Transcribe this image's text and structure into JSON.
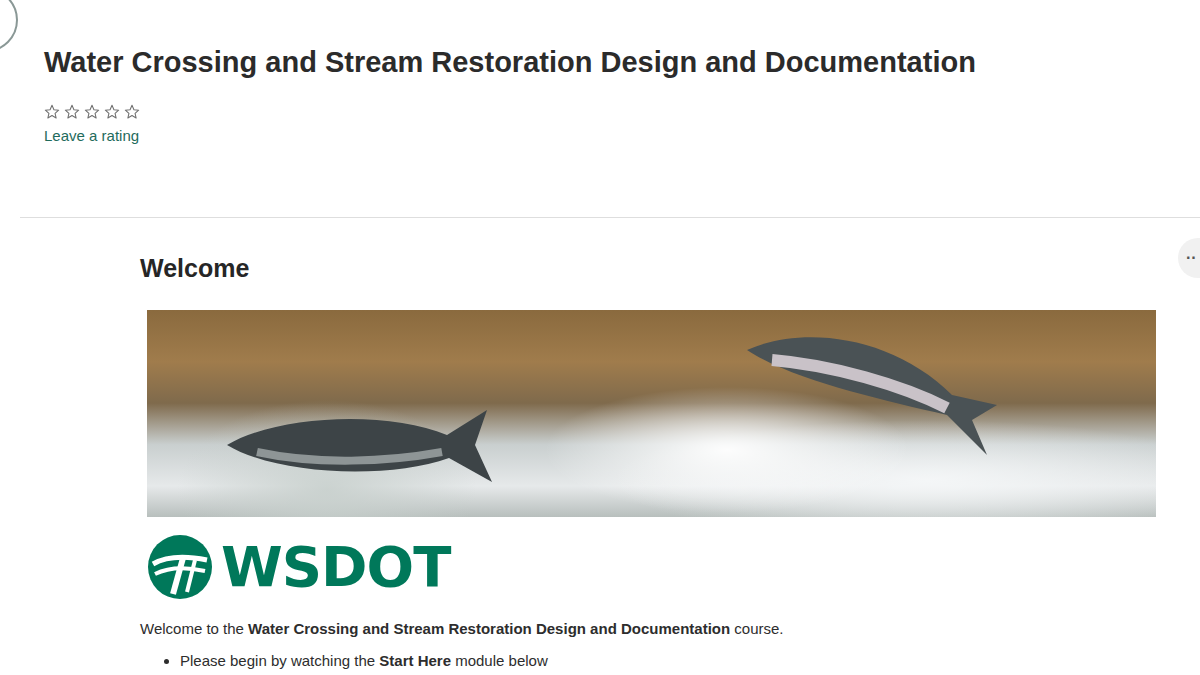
{
  "page": {
    "title": "Water Crossing and Stream Restoration Design and Documentation"
  },
  "rating": {
    "stars": 0,
    "out_of": 5,
    "link": "Leave a rating"
  },
  "more_button": "··",
  "welcome": {
    "heading": "Welcome",
    "logo_text": "WSDOT",
    "intro": [
      {
        "text": "Welcome to the ",
        "kind": "plain"
      },
      {
        "text": "Water Crossing and Stream Restoration Design and Documentation",
        "kind": "bold"
      },
      {
        "text": " course.",
        "kind": "plain"
      }
    ],
    "bullets": [
      [
        {
          "text": "Please begin by watching the ",
          "kind": "plain"
        },
        {
          "text": "Start Here",
          "kind": "bold"
        },
        {
          "text": " module below",
          "kind": "plain"
        }
      ]
    ]
  }
}
